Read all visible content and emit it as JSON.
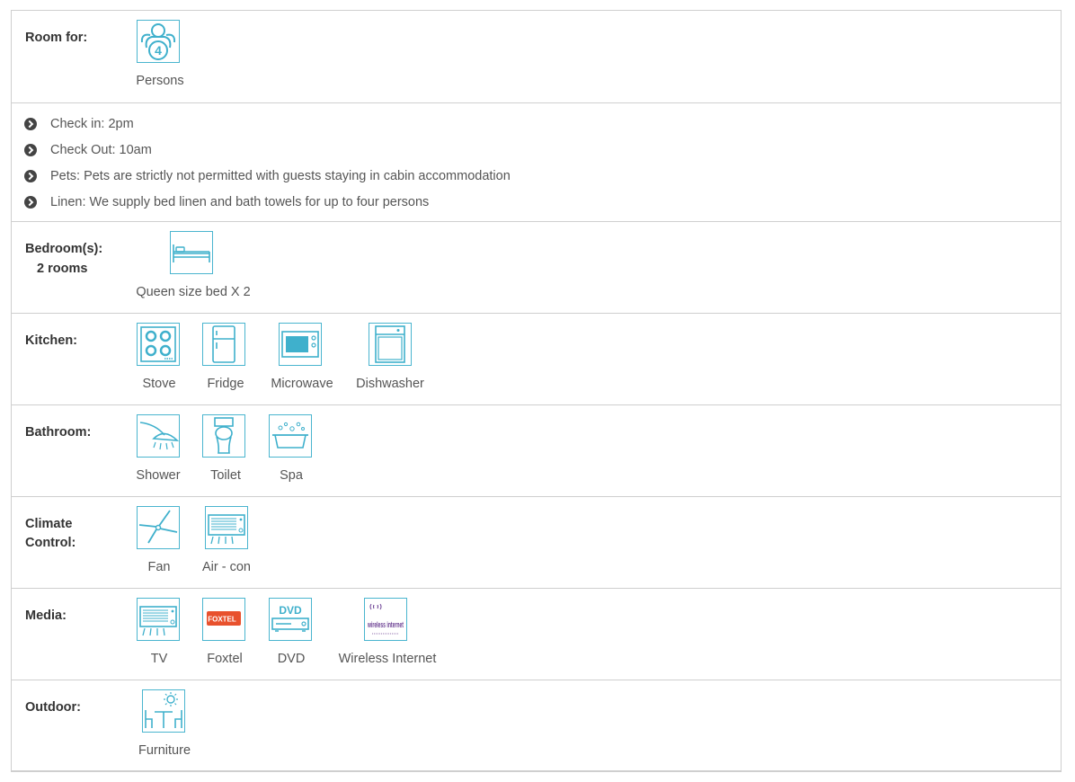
{
  "room_for": {
    "label": "Room for:",
    "icon": "person-4-icon",
    "badge": "4",
    "text": "Persons"
  },
  "info": [
    "Check in: 2pm",
    "Check Out: 10am",
    "Pets: Pets are strictly not permitted with guests staying in cabin accommodation",
    "Linen: We supply bed linen and bath towels for up to four persons"
  ],
  "bedrooms": {
    "label": "Bedroom(s):",
    "sub": "2 rooms",
    "items": [
      {
        "label": "Queen size bed X 2",
        "icon": "bed-icon"
      }
    ]
  },
  "kitchen": {
    "label": "Kitchen:",
    "items": [
      {
        "label": "Stove",
        "icon": "stove-icon"
      },
      {
        "label": "Fridge",
        "icon": "fridge-icon"
      },
      {
        "label": "Microwave",
        "icon": "microwave-icon"
      },
      {
        "label": "Dishwasher",
        "icon": "dishwasher-icon"
      }
    ]
  },
  "bathroom": {
    "label": "Bathroom:",
    "items": [
      {
        "label": "Shower",
        "icon": "shower-icon"
      },
      {
        "label": "Toilet",
        "icon": "toilet-icon"
      },
      {
        "label": "Spa",
        "icon": "spa-icon"
      }
    ]
  },
  "climate": {
    "label": "Climate Control:",
    "items": [
      {
        "label": "Fan",
        "icon": "fan-icon"
      },
      {
        "label": "Air - con",
        "icon": "aircon-icon"
      }
    ]
  },
  "media": {
    "label": "Media:",
    "items": [
      {
        "label": "TV",
        "icon": "tv-icon"
      },
      {
        "label": "Foxtel",
        "icon": "foxtel-icon",
        "logo_text": "FOXTEL"
      },
      {
        "label": "DVD",
        "icon": "dvd-icon",
        "logo_text": "DVD"
      },
      {
        "label": "Wireless Internet",
        "icon": "wireless-internet-icon",
        "logo_text": "wireless internet"
      }
    ]
  },
  "outdoor": {
    "label": "Outdoor:",
    "items": [
      {
        "label": "Furniture",
        "icon": "outdoor-furniture-icon"
      }
    ]
  },
  "colors": {
    "icon_border": "#4ab5cf",
    "icon_stroke": "#3fb0cc",
    "foxtel": "#e8512d",
    "wireless": "#6b3f93",
    "border": "#cfcfcf"
  }
}
